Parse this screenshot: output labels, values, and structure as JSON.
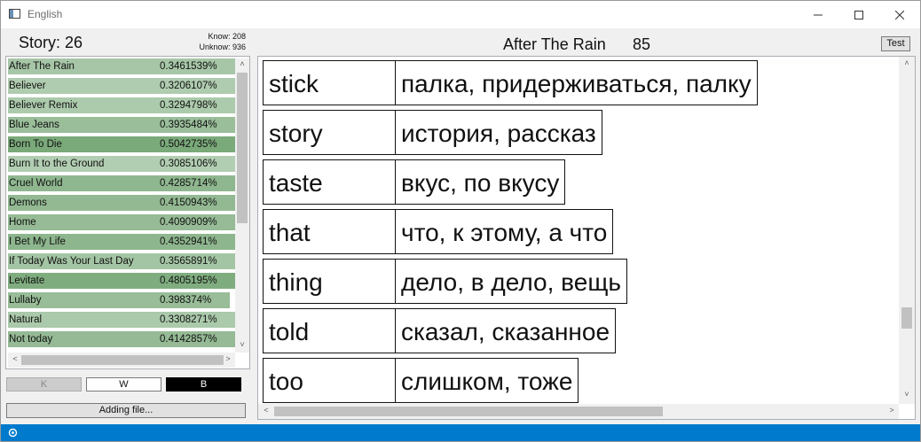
{
  "window": {
    "title": "English"
  },
  "colors": {
    "item_bg": "#8fb58f",
    "statusbar": "#007acc",
    "selected_toggle": "#000000"
  },
  "left": {
    "story_label": "Story: 26",
    "know": "Know: 208",
    "unknow": "Unknow: 936",
    "items": [
      {
        "name": "After The Rain",
        "value": "0.3461539%",
        "level": 0.3461539
      },
      {
        "name": "Believer",
        "value": "0.3206107%",
        "level": 0.3206107
      },
      {
        "name": "Believer Remix",
        "value": "0.3294798%",
        "level": 0.3294798
      },
      {
        "name": "Blue Jeans",
        "value": "0.3935484%",
        "level": 0.3935484
      },
      {
        "name": "Born To Die",
        "value": "0.5042735%",
        "level": 0.5042735
      },
      {
        "name": "Burn It to the Ground",
        "value": "0.3085106%",
        "level": 0.3085106
      },
      {
        "name": "Cruel World",
        "value": "0.4285714%",
        "level": 0.4285714
      },
      {
        "name": "Demons",
        "value": "0.4150943%",
        "level": 0.4150943
      },
      {
        "name": "Home",
        "value": "0.4090909%",
        "level": 0.4090909
      },
      {
        "name": "I Bet My Life",
        "value": "0.4352941%",
        "level": 0.4352941
      },
      {
        "name": "If Today Was Your Last Day",
        "value": "0.3565891%",
        "level": 0.3565891
      },
      {
        "name": "Levitate",
        "value": "0.4805195%",
        "level": 0.4805195
      },
      {
        "name": "Lullaby",
        "value": "0.398374%",
        "level": 0.398374
      },
      {
        "name": "Natural",
        "value": "0.3308271%",
        "level": 0.3308271
      },
      {
        "name": "Not today",
        "value": "0.4142857%",
        "level": 0.4142857
      }
    ],
    "buttons": {
      "k": "K",
      "w": "W",
      "b": "B",
      "add": "Adding file..."
    }
  },
  "main": {
    "song_title": "After The Rain",
    "song_count": "85",
    "test_label": "Test",
    "words": [
      {
        "word": "stick",
        "translation": "палка, придерживаться, палку"
      },
      {
        "word": "story",
        "translation": "история, рассказ"
      },
      {
        "word": "taste",
        "translation": "вкус, по вкусу"
      },
      {
        "word": "that",
        "translation": "что, к этому, а что"
      },
      {
        "word": "thing",
        "translation": "дело, в дело, вещь"
      },
      {
        "word": "told",
        "translation": "сказал, сказанное"
      },
      {
        "word": "too",
        "translation": "слишком, тоже"
      }
    ]
  }
}
